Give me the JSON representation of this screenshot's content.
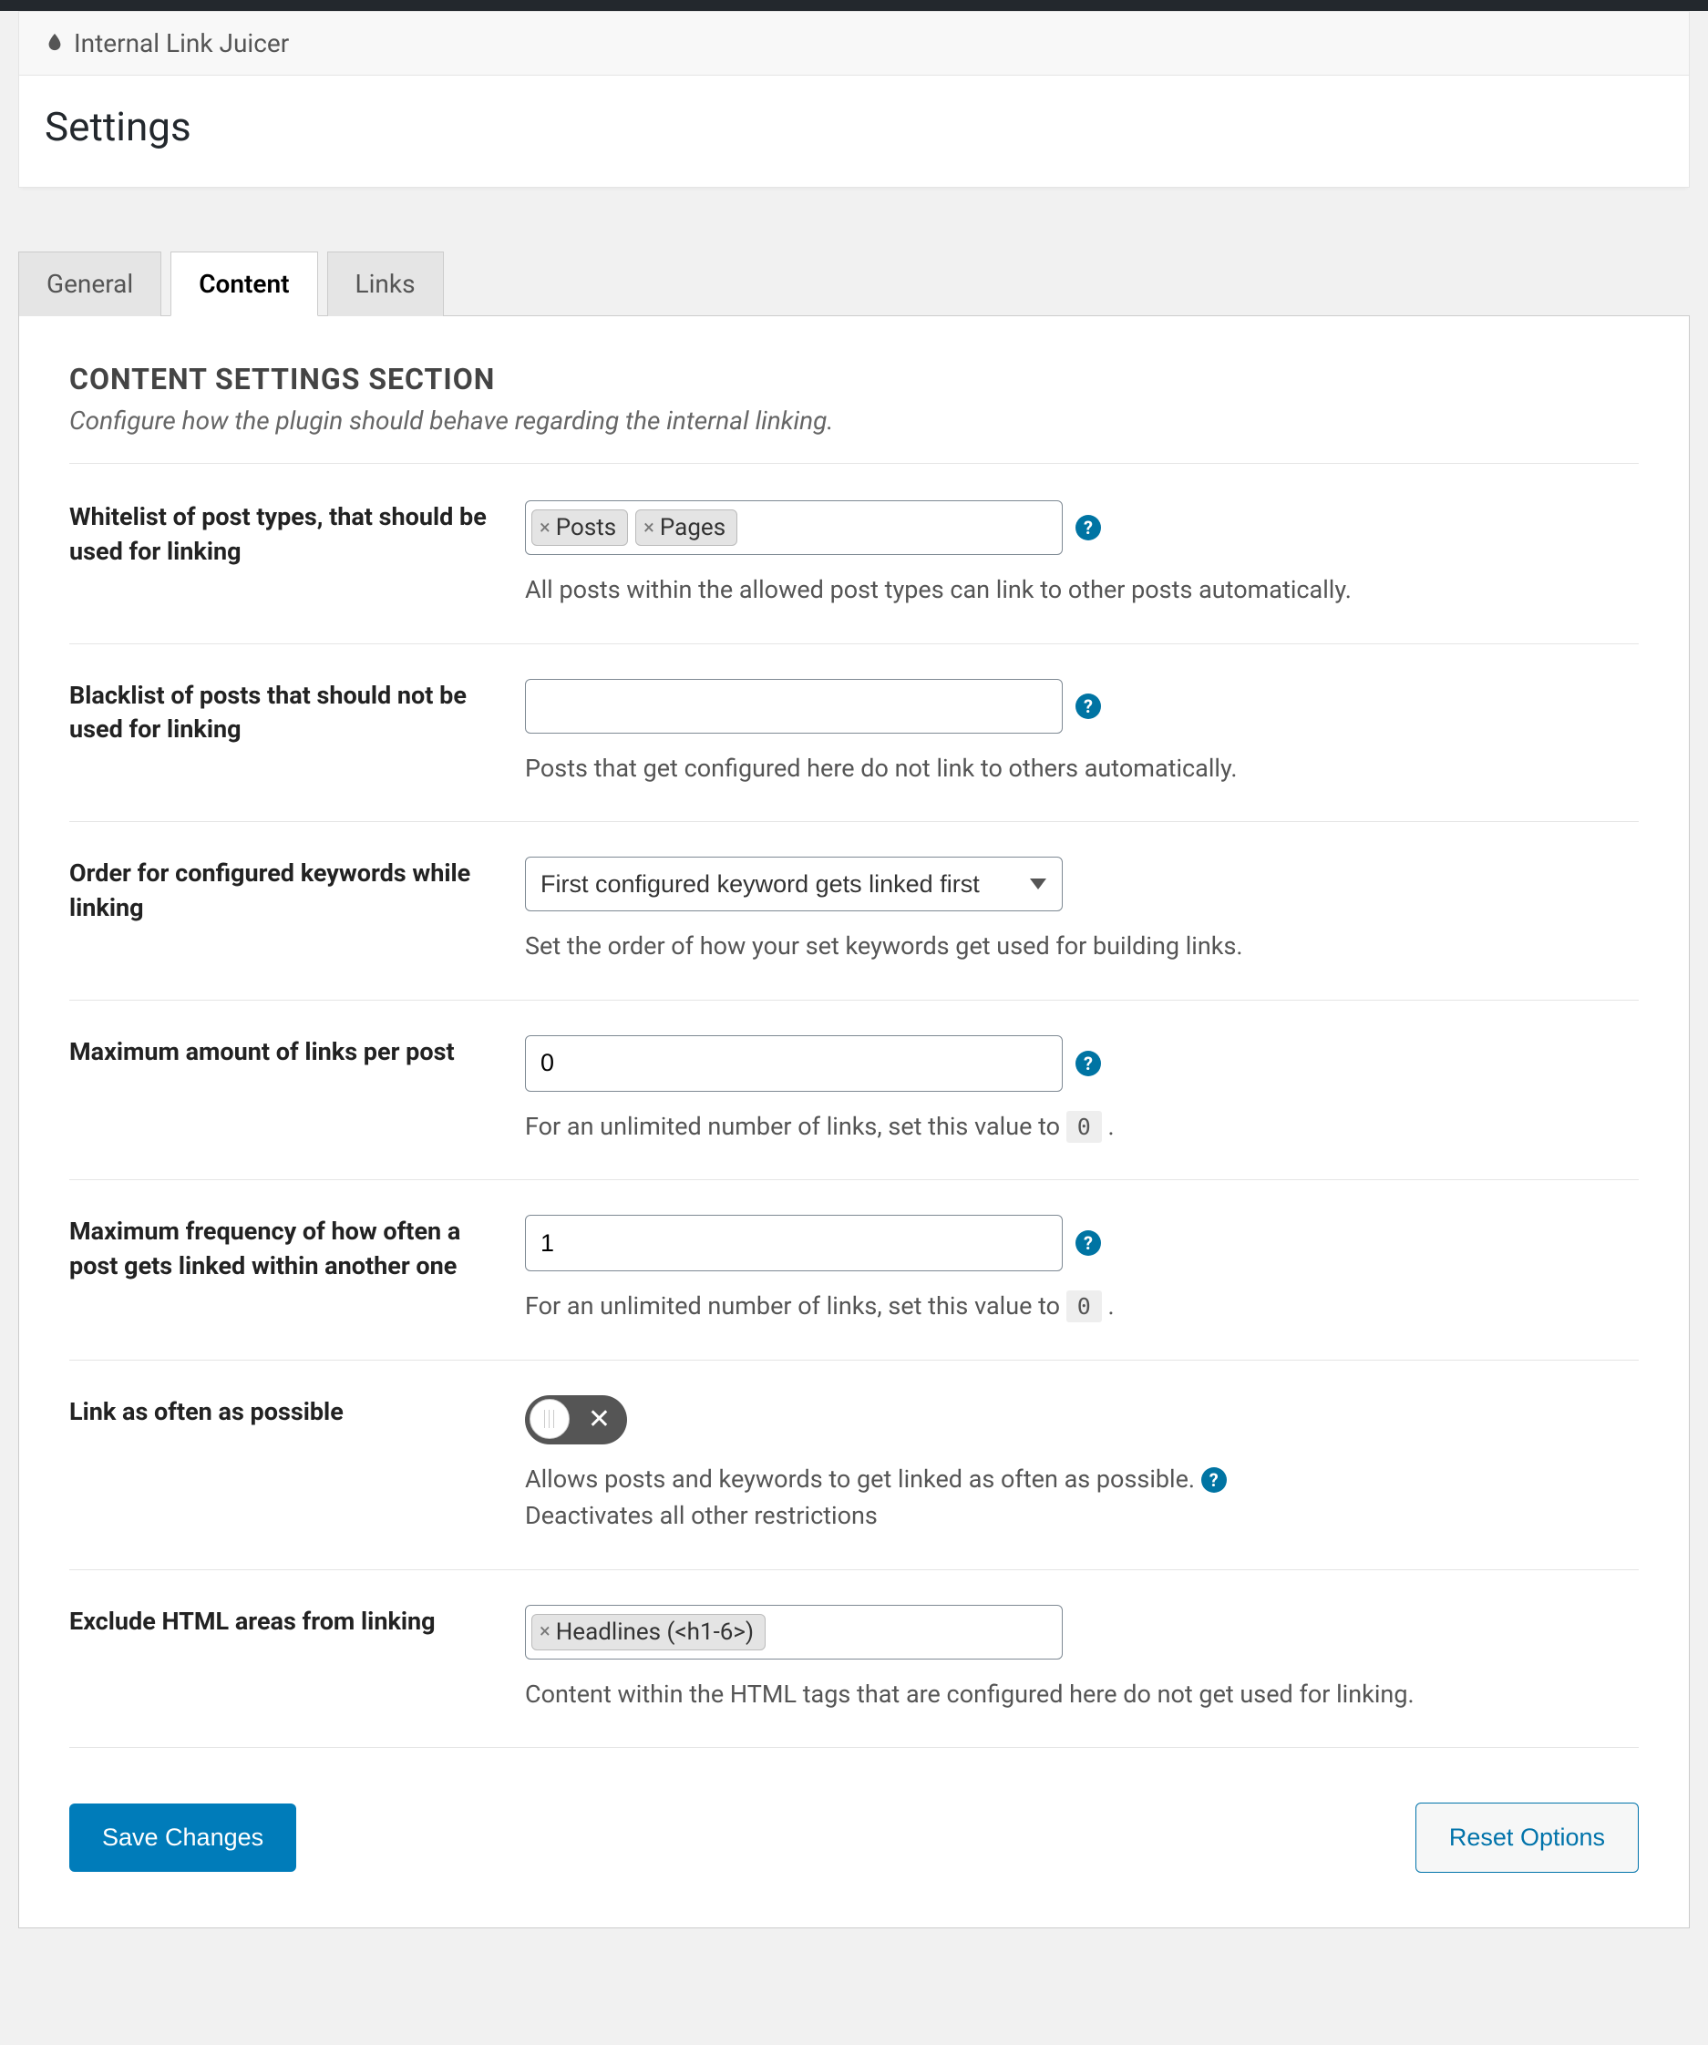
{
  "plugin_name": "Internal Link Juicer",
  "page_title": "Settings",
  "tabs": {
    "general": "General",
    "content": "Content",
    "links": "Links"
  },
  "section": {
    "title": "CONTENT SETTINGS SECTION",
    "desc": "Configure how the plugin should behave regarding the internal linking."
  },
  "whitelist": {
    "label": "Whitelist of post types, that should be used for linking",
    "tags": [
      "Posts",
      "Pages"
    ],
    "hint": "All posts within the allowed post types can link to other posts automatically."
  },
  "blacklist": {
    "label": "Blacklist of posts that should not be used for linking",
    "hint": "Posts that get configured here do not link to others automatically."
  },
  "order": {
    "label": "Order for configured keywords while linking",
    "value": "First configured keyword gets linked first",
    "hint": "Set the order of how your set keywords get used for building links."
  },
  "max_links": {
    "label": "Maximum amount of links per post",
    "value": "0",
    "hint_pre": "For an unlimited number of links, set this value to ",
    "hint_code": "0",
    "hint_post": " ."
  },
  "max_freq": {
    "label": "Maximum frequency of how often a post gets linked within another one",
    "value": "1",
    "hint_pre": "For an unlimited number of links, set this value to ",
    "hint_code": "0",
    "hint_post": " ."
  },
  "link_often": {
    "label": "Link as often as possible",
    "hint1": "Allows posts and keywords to get linked as often as possible. ",
    "hint2": "Deactivates all other restrictions"
  },
  "exclude": {
    "label": "Exclude HTML areas from linking",
    "tags": [
      "Headlines (<h1-6>)"
    ],
    "hint": "Content within the HTML tags that are configured here do not get used for linking."
  },
  "buttons": {
    "save": "Save Changes",
    "reset": "Reset Options"
  }
}
